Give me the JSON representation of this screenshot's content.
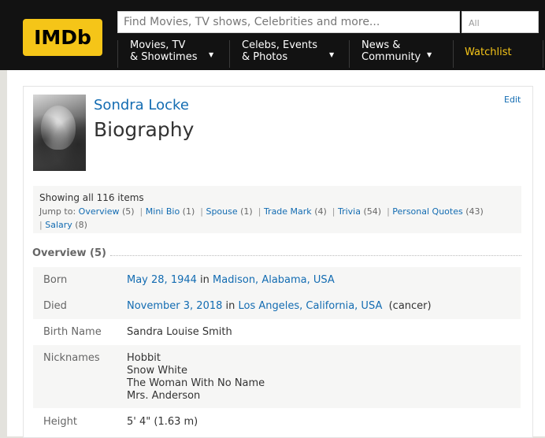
{
  "header": {
    "logo": "IMDb",
    "search_placeholder": "Find Movies, TV shows, Celebrities and more...",
    "search_category": "All",
    "nav": {
      "movies_tv_1": "Movies, TV",
      "movies_tv_2": "& Showtimes",
      "celebs_1": "Celebs, Events",
      "celebs_2": "& Photos",
      "news_1": "News &",
      "news_2": "Community",
      "watchlist": "Watchlist"
    }
  },
  "person": {
    "name": "Sondra Locke",
    "page_title": "Biography",
    "edit_label": "Edit"
  },
  "items": {
    "showing": "Showing all 116 items",
    "jump_to_label": "Jump to:",
    "links": [
      {
        "label": "Overview",
        "count": "(5)"
      },
      {
        "label": "Mini Bio",
        "count": "(1)"
      },
      {
        "label": "Spouse",
        "count": "(1)"
      },
      {
        "label": "Trade Mark",
        "count": "(4)"
      },
      {
        "label": "Trivia",
        "count": "(54)"
      },
      {
        "label": "Personal Quotes",
        "count": "(43)"
      },
      {
        "label": "Salary",
        "count": "(8)"
      }
    ]
  },
  "overview": {
    "heading": "Overview (5)",
    "born_label": "Born",
    "born_date": "May 28, 1944",
    "born_in": "in",
    "born_place": "Madison, Alabama, USA",
    "died_label": "Died",
    "died_date": "November 3, 2018",
    "died_in": "in",
    "died_place": "Los Angeles, California, USA",
    "died_cause": "(cancer)",
    "birthname_label": "Birth Name",
    "birthname": "Sandra Louise Smith",
    "nicknames_label": "Nicknames",
    "nicknames": [
      "Hobbit",
      "Snow White",
      "The Woman With No Name",
      "Mrs. Anderson"
    ],
    "height_label": "Height",
    "height": "5' 4\" (1.63 m)"
  },
  "colors": {
    "brand": "#f5c518",
    "link": "#136cb2",
    "header_bg": "#121212"
  }
}
